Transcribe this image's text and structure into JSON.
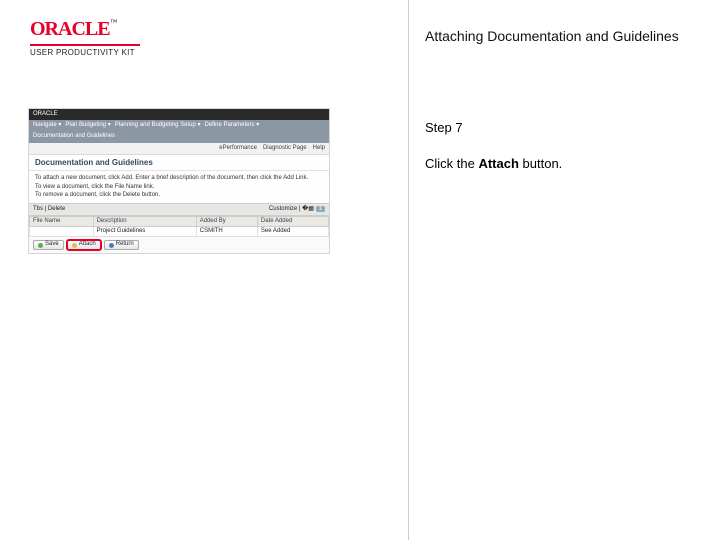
{
  "brand": {
    "logo": "ORACLE",
    "tm": "™",
    "sub": "USER PRODUCTIVITY KIT"
  },
  "title": "Attaching Documentation and Guidelines",
  "step": "Step 7",
  "instruction": {
    "pre": "Click the ",
    "bold": "Attach",
    "post": " button."
  },
  "shot": {
    "top": "ORACLE",
    "menu": [
      "Navigate ▾",
      "Plan Budgeting ▾",
      "Planning and Budgeting Setup ▾",
      "Define Parameters ▾",
      "Documentation and Guidelines"
    ],
    "util": [
      "ePerformance",
      "Diagnostic Page",
      "Help"
    ],
    "pageTitle": "Documentation and Guidelines",
    "helpLines": [
      "To attach a new document, click Add. Enter a brief description of the document, then click the Add Link.",
      "To view a document, click the File Name link.",
      "To remove a document, click the Delete button."
    ],
    "tbs": {
      "label": "Tbs | Delete",
      "cust": "Customize | �▦"
    },
    "cols": [
      "File Name",
      "Description",
      "Added By",
      "Date Added"
    ],
    "row": {
      "file": "",
      "desc": "Project Guidelines",
      "by": "CSMITH",
      "date": "See Added"
    },
    "buttons": {
      "save": "Save",
      "attach": "Attach",
      "return": "Return"
    }
  }
}
